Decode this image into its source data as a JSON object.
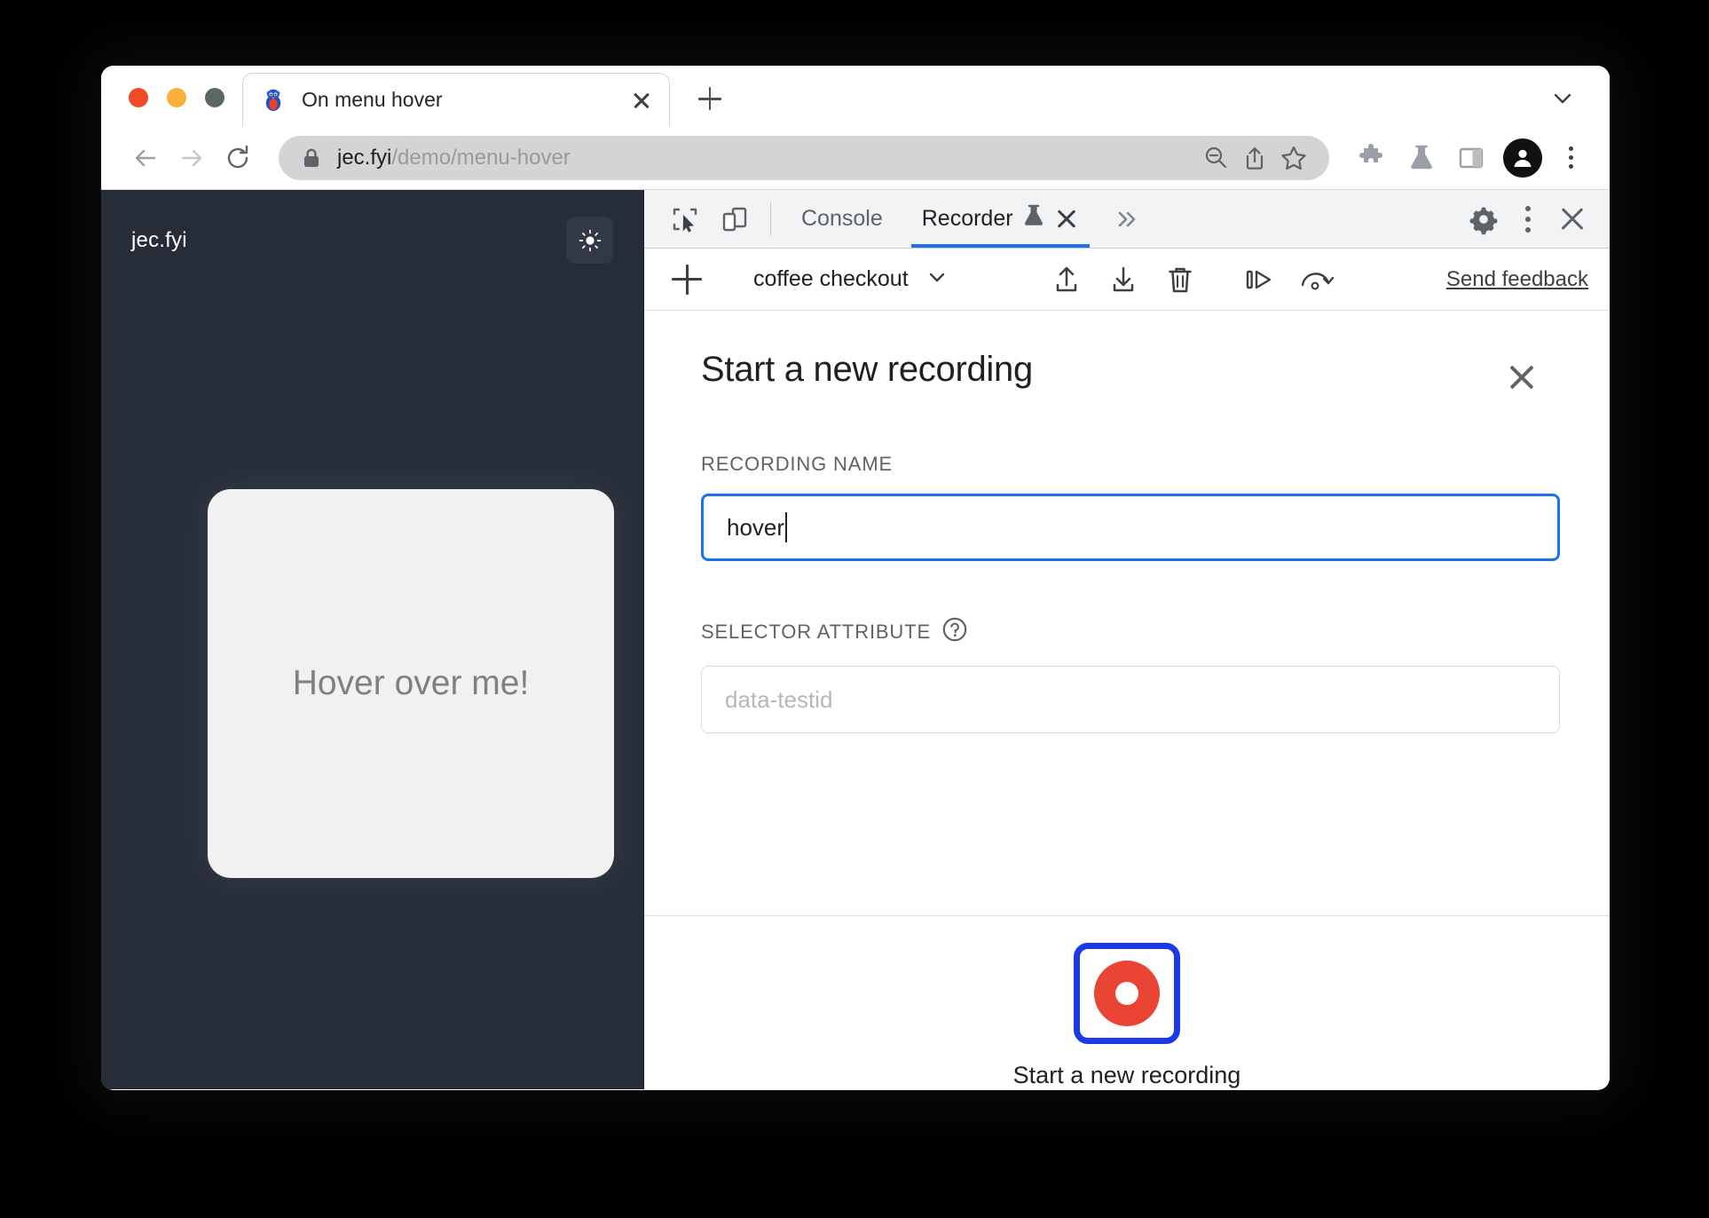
{
  "browser": {
    "window_controls": [
      "close",
      "minimize",
      "maximize"
    ],
    "tab": {
      "title": "On menu hover",
      "favicon": "penguin-favicon",
      "close_label": "x"
    },
    "new_tab_label": "+",
    "tabstrip_chevron": "chevron-down-icon",
    "toolbar": {
      "back": "back-arrow-icon",
      "forward": "forward-arrow-icon",
      "reload": "reload-icon",
      "lock": "lock-icon",
      "url_host": "jec.fyi",
      "url_path": "/demo/menu-hover",
      "zoom_out": "zoom-out-icon",
      "share": "share-icon",
      "bookmark": "star-icon",
      "extensions": "puzzle-piece-icon",
      "experiments": "flask-icon",
      "side_panel": "side-panel-icon",
      "profile": "avatar-icon",
      "menu": "three-dot-menu-icon"
    }
  },
  "page": {
    "logo": "jec.fyi",
    "theme_toggle": "sun-icon",
    "card_text": "Hover over me!",
    "background_color": "#262c38",
    "card_color": "#f1f1f1"
  },
  "devtools": {
    "inspect_icon": "inspect-element-icon",
    "device_toolbar_icon": "device-toolbar-icon",
    "tabs": [
      {
        "label": "Console",
        "active": false
      },
      {
        "label": "Recorder",
        "active": true,
        "badge": "flask-icon",
        "closable": true
      }
    ],
    "more_tabs": "»",
    "settings_icon": "gear-icon",
    "menu_icon": "three-dot-menu-icon",
    "close_icon": "close-icon",
    "accent_color": "#1a73e8"
  },
  "recorder": {
    "toolbar": {
      "add_label": "+",
      "selected_recording": "coffee checkout",
      "dropdown_icon": "chevron-down-icon",
      "import_icon": "upload-icon",
      "export_icon": "download-icon",
      "delete_icon": "trash-icon",
      "replay_step_icon": "step-replay-icon",
      "replay_speed_icon": "replay-speed-icon",
      "feedback_label": "Send feedback"
    },
    "form": {
      "title": "Start a new recording",
      "close_icon": "close-icon",
      "recording_name": {
        "label": "RECORDING NAME",
        "value": "hover",
        "placeholder": "Recording name"
      },
      "selector_attribute": {
        "label": "SELECTOR ATTRIBUTE",
        "help_icon": "help-circle-icon",
        "value": "",
        "placeholder": "data-testid"
      },
      "record_button": {
        "label": "Start a new recording",
        "icon": "record-circle-icon",
        "focus_color": "#1a3ae8",
        "record_color": "#ea4435"
      }
    }
  }
}
